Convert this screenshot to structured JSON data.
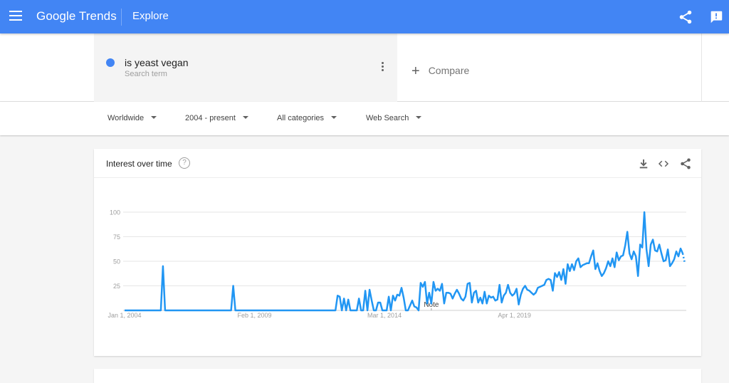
{
  "topbar": {
    "brand": "Google Trends",
    "section": "Explore",
    "icons": [
      "menu-icon",
      "share-icon",
      "feedback-icon"
    ],
    "color": "#4285f4"
  },
  "search": {
    "term": "is yeast vegan",
    "term_sublabel": "Search term",
    "term_color": "#4285f4",
    "compare_label": "Compare"
  },
  "filters": [
    {
      "label": "Worldwide"
    },
    {
      "label": "2004 - present"
    },
    {
      "label": "All categories"
    },
    {
      "label": "Web Search"
    }
  ],
  "card": {
    "title": "Interest over time",
    "help": "?",
    "actions": [
      "download-icon",
      "embed-icon",
      "share-icon"
    ]
  },
  "chart_data": {
    "type": "line",
    "title": "Interest over time",
    "xlabel": "",
    "ylabel": "",
    "ylim": [
      0,
      100
    ],
    "yticks": [
      25,
      50,
      75,
      100
    ],
    "xtick_labels": [
      "Jan 1, 2004",
      "Feb 1, 2009",
      "Mar 1, 2014",
      "Apr 1, 2019"
    ],
    "xtick_month_index": [
      0,
      61,
      122,
      183
    ],
    "annotation": {
      "label": "Note",
      "month_index": 144
    },
    "grid": true,
    "series": [
      {
        "name": "is yeast vegan",
        "color": "#2196f3",
        "start": "2004-01",
        "interval": "month",
        "partial_last_point": true,
        "values": [
          0,
          0,
          0,
          0,
          0,
          0,
          0,
          0,
          0,
          0,
          0,
          0,
          0,
          0,
          0,
          0,
          0,
          0,
          45,
          0,
          0,
          0,
          0,
          0,
          0,
          0,
          0,
          0,
          0,
          0,
          0,
          0,
          0,
          0,
          0,
          0,
          0,
          0,
          0,
          0,
          0,
          0,
          0,
          0,
          0,
          0,
          0,
          0,
          0,
          0,
          0,
          25,
          0,
          0,
          0,
          0,
          0,
          0,
          0,
          0,
          0,
          0,
          0,
          0,
          0,
          0,
          0,
          0,
          0,
          0,
          0,
          0,
          0,
          0,
          0,
          0,
          0,
          0,
          0,
          0,
          0,
          0,
          0,
          0,
          0,
          0,
          0,
          0,
          0,
          0,
          0,
          0,
          0,
          0,
          0,
          0,
          0,
          0,
          0,
          0,
          15,
          14,
          0,
          12,
          0,
          11,
          0,
          0,
          0,
          0,
          12,
          0,
          0,
          20,
          0,
          21,
          10,
          0,
          0,
          8,
          8,
          0,
          0,
          0,
          14,
          0,
          15,
          10,
          16,
          15,
          23,
          13,
          0,
          0,
          5,
          10,
          4,
          3,
          0,
          28,
          24,
          29,
          7,
          18,
          7,
          29,
          20,
          22,
          20,
          27,
          7,
          18,
          18,
          17,
          12,
          17,
          21,
          17,
          12,
          10,
          14,
          27,
          28,
          8,
          18,
          20,
          8,
          13,
          7,
          19,
          7,
          15,
          13,
          14,
          10,
          11,
          26,
          8,
          15,
          18,
          26,
          18,
          15,
          17,
          22,
          6,
          16,
          22,
          25,
          21,
          20,
          18,
          16,
          18,
          23,
          24,
          25,
          26,
          31,
          32,
          31,
          20,
          38,
          34,
          39,
          31,
          42,
          27,
          47,
          40,
          47,
          41,
          50,
          53,
          44,
          46,
          47,
          48,
          48,
          55,
          61,
          42,
          48,
          40,
          35,
          38,
          43,
          50,
          45,
          53,
          44,
          59,
          51,
          55,
          56,
          66,
          80,
          58,
          52,
          60,
          55,
          35,
          67,
          64,
          100,
          62,
          45,
          67,
          72,
          61,
          60,
          67,
          58,
          50,
          51,
          62,
          45,
          48,
          52,
          60,
          55,
          63,
          58,
          48
        ]
      }
    ]
  }
}
